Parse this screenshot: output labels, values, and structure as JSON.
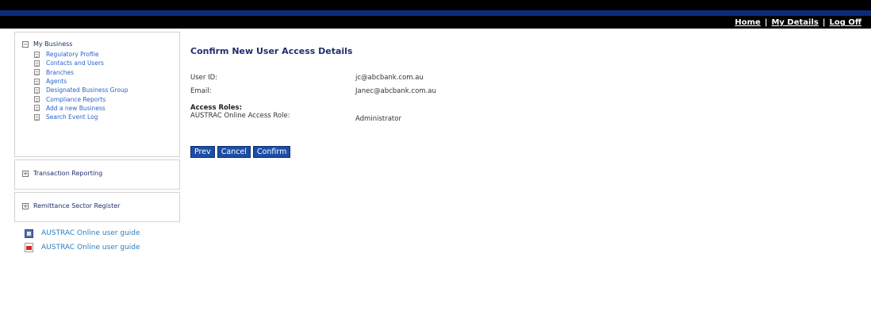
{
  "header": {
    "links": [
      "Home",
      "My Details",
      "Log Off"
    ],
    "separator": "|"
  },
  "sidebar": {
    "my_business": {
      "toggle": "−",
      "label": "My Business",
      "items": [
        "Regulatory Profile",
        "Contacts and Users",
        "Branches",
        "Agents",
        "Designated Business Group",
        "Compliance Reports",
        "Add a new Business",
        "Search Event Log"
      ]
    },
    "transaction_reporting": {
      "toggle": "+",
      "label": "Transaction Reporting"
    },
    "remittance_register": {
      "toggle": "+",
      "label": "Remittance Sector Register"
    },
    "guides": [
      {
        "label": "AUSTRAC Online user guide",
        "icon": "word-document-icon"
      },
      {
        "label": "AUSTRAC Online user guide",
        "icon": "pdf-icon"
      }
    ]
  },
  "main": {
    "title": "Confirm New User Access Details",
    "user_id_label": "User ID:",
    "user_id_value": "jc@abcbank.com.au",
    "email_label": "Email:",
    "email_value": "Janec@abcbank.com.au",
    "access_roles_heading": "Access Roles:",
    "role_label": "AUSTRAC Online Access Role:",
    "role_value": "Administrator",
    "buttons": {
      "prev": "Prev",
      "cancel": "Cancel",
      "confirm": "Confirm"
    }
  }
}
